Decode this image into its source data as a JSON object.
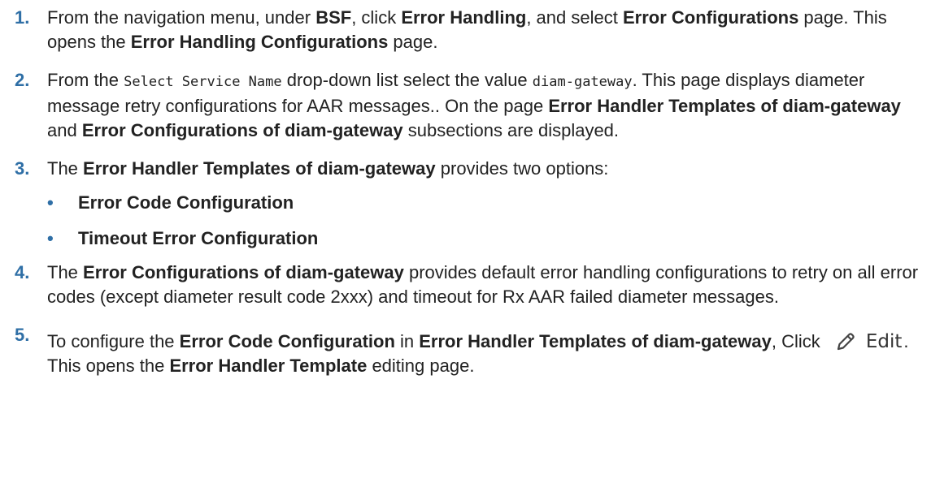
{
  "steps": [
    {
      "num": "1.",
      "t1": "From the navigation menu, under ",
      "b1": "BSF",
      "t2": ", click ",
      "b2": "Error Handling",
      "t3": ", and select ",
      "b3": "Error Configurations",
      "t4": " page. This opens the ",
      "b4": "Error Handling Configurations",
      "t5": " page."
    },
    {
      "num": "2.",
      "t1": "From the ",
      "c1": "Select Service Name",
      "t2": " drop-down list select the value ",
      "c2": "diam-gateway",
      "t3": ". This page displays diameter message retry configurations for AAR messages.. On the page ",
      "b1": "Error Handler Templates of diam-gateway",
      "t4": " and ",
      "b2": "Error Configurations of diam-gateway",
      "t5": " subsections are displayed."
    },
    {
      "num": "3.",
      "t1": "The ",
      "b1": "Error Handler Templates of diam-gateway",
      "t2": " provides two options:",
      "bullets": [
        "Error Code Configuration",
        "Timeout Error Configuration"
      ]
    },
    {
      "num": "4.",
      "t1": "The ",
      "b1": "Error Configurations of diam-gateway",
      "t2": " provides default error handling configurations to retry on all error codes (except diameter result code 2xxx) and timeout for Rx AAR failed diameter messages."
    },
    {
      "num": "5.",
      "t1": "To configure the ",
      "b1": "Error Code Configuration",
      "t2": " in ",
      "b2": "Error Handler Templates of diam-gateway",
      "t3": " , Click ",
      "edit_label": "Edit",
      "t4": ".",
      "t5": "This opens the ",
      "b3": "Error Handler Template",
      "t6": " editing page."
    }
  ],
  "bullet_glyph": "•",
  "edit_icon": "pencil-icon",
  "accent_color": "#2f6fa6"
}
